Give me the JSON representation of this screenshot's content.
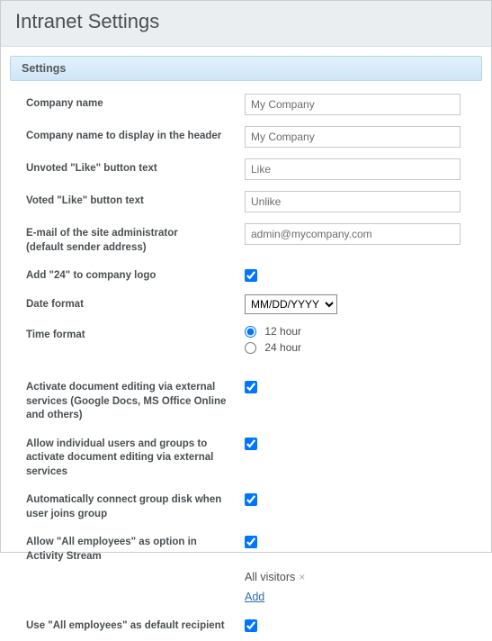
{
  "page_title": "Intranet Settings",
  "section_title": "Settings",
  "fields": {
    "company_name": {
      "label": "Company name",
      "value": "My Company"
    },
    "company_name_header": {
      "label": "Company name to display in the header",
      "value": "My Company"
    },
    "unvoted_like": {
      "label": "Unvoted \"Like\" button text",
      "value": "Like"
    },
    "voted_like": {
      "label": "Voted \"Like\" button text",
      "value": "Unlike"
    },
    "admin_email": {
      "label": "E-mail of the site administrator",
      "sublabel": "(default sender address)",
      "value": "admin@mycompany.com"
    },
    "add24": {
      "label": "Add \"24\" to company logo",
      "checked": true
    },
    "date_format": {
      "label": "Date format",
      "value": "MM/DD/YYYY",
      "options": [
        "MM/DD/YYYY"
      ]
    },
    "time_format": {
      "label": "Time format",
      "options": [
        "12 hour",
        "24 hour"
      ],
      "selected": "12 hour"
    },
    "external_editing": {
      "label": "Activate document editing via external services (Google Docs, MS Office Online and others)",
      "checked": true
    },
    "allow_user_external": {
      "label": "Allow individual users and groups to activate document editing via external services",
      "checked": true
    },
    "auto_group_disk": {
      "label": "Automatically connect group disk when user joins group",
      "checked": true
    },
    "allow_all_employees_stream": {
      "label": "Allow \"All employees\" as option in Activity Stream",
      "checked": true,
      "tag": "All visitors",
      "add_link": "Add"
    },
    "default_recipient": {
      "label": "Use \"All employees\" as default recipient",
      "checked": true
    }
  }
}
